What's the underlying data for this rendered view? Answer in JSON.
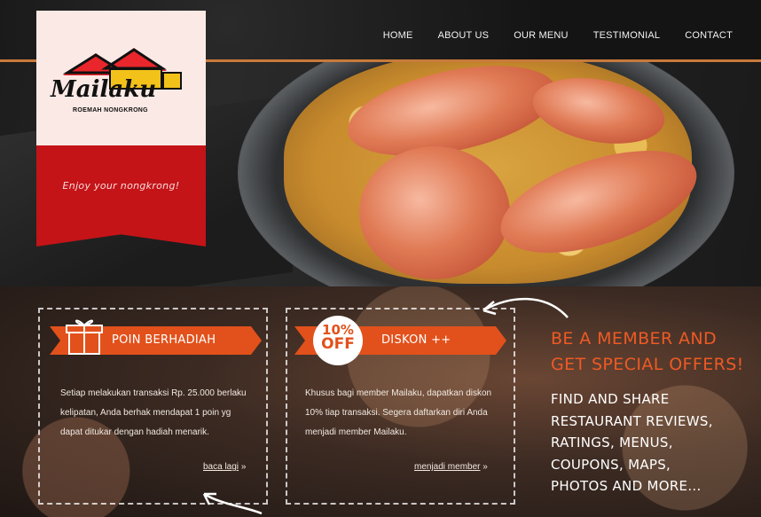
{
  "nav": {
    "items": [
      {
        "label": "HOME"
      },
      {
        "label": "ABOUT US"
      },
      {
        "label": "OUR MENU"
      },
      {
        "label": "TESTIMONIAL"
      },
      {
        "label": "CONTACT"
      }
    ]
  },
  "logo": {
    "brand": "Mailaku",
    "subtitle": "ROEMAH NONGKRONG",
    "tagline": "Enjoy your nongkrong!"
  },
  "offers": [
    {
      "title": "POIN BERHADIAH",
      "icon": "gift-icon",
      "text": "Setiap melakukan transaksi Rp. 25.000 berlaku kelipatan, Anda berhak mendapat 1 poin yg dapat ditukar dengan hadiah menarik.",
      "link": "baca lagi",
      "link_suffix": "»"
    },
    {
      "title": "DISKON ++",
      "badge_percent": "10%",
      "badge_off": "OFF",
      "text": "Khusus bagi member Mailaku, dapatkan diskon 10% tiap transaksi. Segera daftarkan diri Anda menjadi member Mailaku.",
      "link": "menjadi member",
      "link_suffix": "»"
    }
  ],
  "promo": {
    "headline_line1": "BE A MEMBER AND",
    "headline_line2": "GET SPECIAL OFFERS!",
    "list_line1": "FIND AND SHARE",
    "list_line2": "RESTAURANT REVIEWS,",
    "list_line3": "RATINGS, MENUS,",
    "list_line4": "COUPONS, MAPS,",
    "list_line5": "PHOTOS AND MORE..."
  },
  "colors": {
    "accent_orange": "#e2511b",
    "brand_red": "#c41418",
    "nav_rule": "#c87a3a"
  }
}
